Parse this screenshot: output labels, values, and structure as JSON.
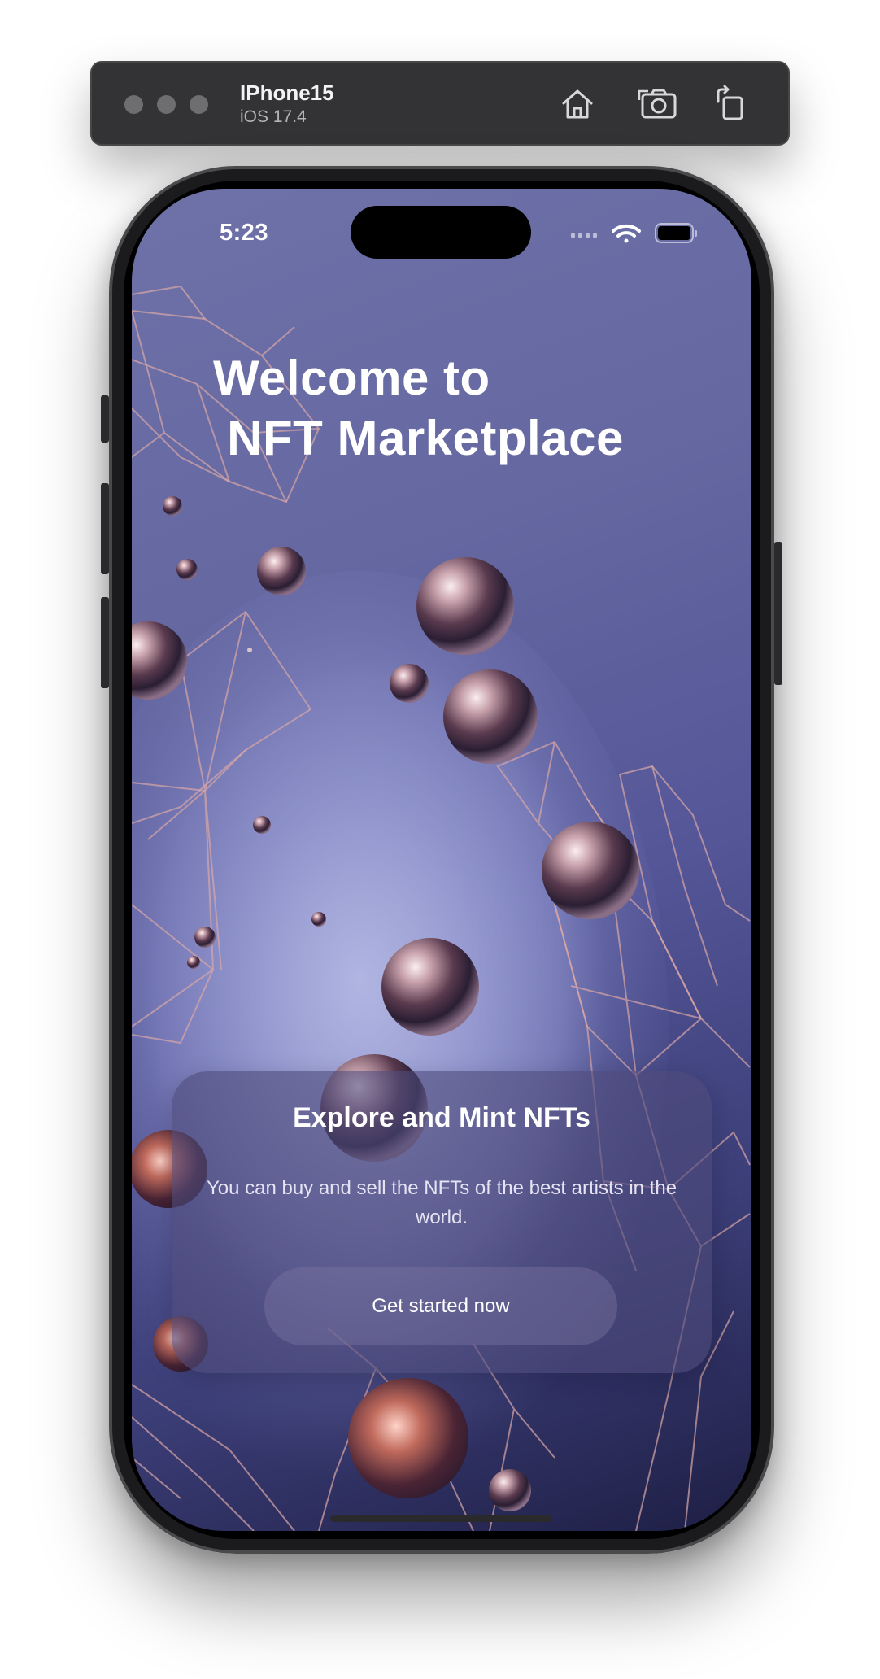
{
  "simulator": {
    "device_name": "IPhone15",
    "os_version": "iOS 17.4",
    "icons": [
      "home-icon",
      "screenshot-icon",
      "rotate-icon"
    ]
  },
  "status_bar": {
    "time": "5:23",
    "icons": [
      "cellular-signal-icon",
      "wifi-icon",
      "battery-icon"
    ]
  },
  "welcome": {
    "title": "Welcome to\n NFT Marketplace"
  },
  "card": {
    "title": "Explore and Mint NFTs",
    "description": "You can buy and sell the NFTs of the best artists in the world.",
    "button_label": "Get started now"
  },
  "colors": {
    "background_top": "#6e72a8",
    "background_bottom": "#1e1f45",
    "card": "#4e4a7a",
    "text": "#ffffff"
  }
}
